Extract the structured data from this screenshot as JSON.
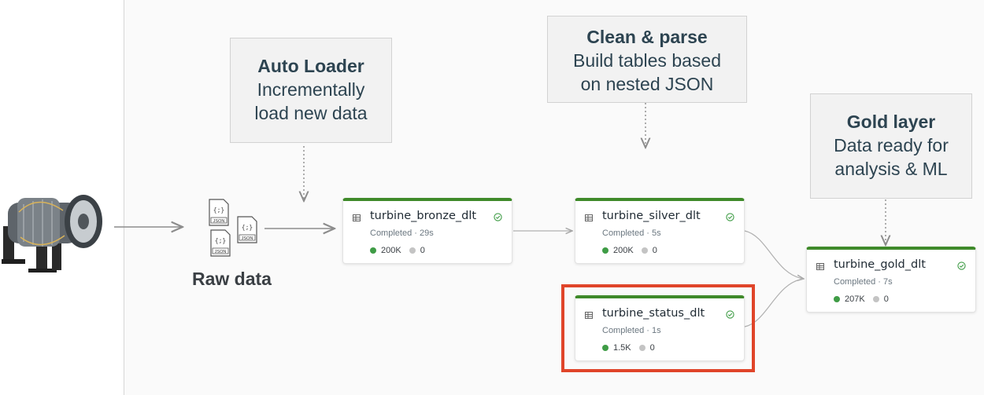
{
  "callouts": {
    "auto_loader": {
      "title": "Auto Loader",
      "lines": [
        "Incrementally",
        "load new data"
      ]
    },
    "clean_parse": {
      "title": "Clean & parse",
      "lines": [
        "Build tables based",
        "on nested JSON"
      ]
    },
    "gold_layer": {
      "title": "Gold layer",
      "lines": [
        "Data ready for",
        "analysis & ML"
      ]
    }
  },
  "raw_data": {
    "label": "Raw data",
    "file_label": "JSON",
    "file_glyph": "{;}"
  },
  "nodes": {
    "bronze": {
      "name": "turbine_bronze_dlt",
      "status": "Completed · 29s",
      "rows": "200K",
      "dropped": "0"
    },
    "silver": {
      "name": "turbine_silver_dlt",
      "status": "Completed · 5s",
      "rows": "200K",
      "dropped": "0"
    },
    "status": {
      "name": "turbine_status_dlt",
      "status": "Completed · 1s",
      "rows": "1.5K",
      "dropped": "0"
    },
    "gold": {
      "name": "turbine_gold_dlt",
      "status": "Completed · 7s",
      "rows": "207K",
      "dropped": "0"
    }
  },
  "colors": {
    "node_top_border": "#3f8a2a",
    "highlight": "#e0452a",
    "callout_text": "#2d4451",
    "metric_dot": "#3f9c46"
  },
  "icons": {
    "node_type": "table-icon",
    "node_state": "check-circle-icon"
  }
}
